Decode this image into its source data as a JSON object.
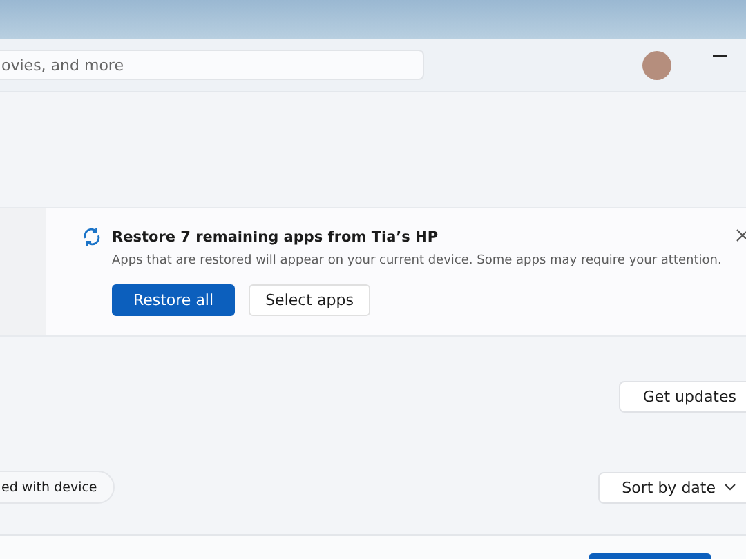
{
  "search": {
    "placeholder": "ovies, and more"
  },
  "banner": {
    "title": "Restore 7 remaining apps from Tia’s HP",
    "description": "Apps that are restored will appear on your current device. Some apps may require your attention.",
    "buttons": [
      {
        "label": "Restore all",
        "kind": "primary"
      },
      {
        "label": "Select apps",
        "kind": "secondary"
      }
    ]
  },
  "get_updates": "Get updates",
  "filter_chip": "ed with device",
  "sort": "Sort by date"
}
